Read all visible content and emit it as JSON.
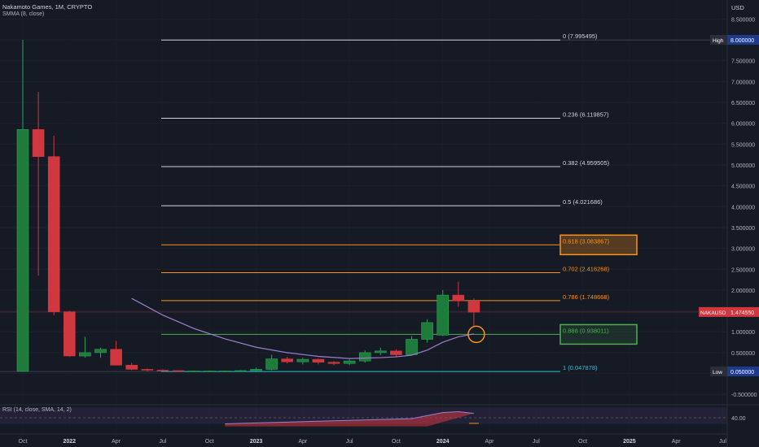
{
  "header": {
    "symbol_line": "Nakamoto Games, 1M, CRYPTO",
    "indicator": "SMMA (8, close)",
    "currency": "USD"
  },
  "rsi_panel": {
    "label": "RSI (14, close, SMA, 14, 2)",
    "tick_label": "40.00",
    "tick_value": 40
  },
  "colors": {
    "background": "#161a25",
    "up": "#26a69a",
    "up_fill": "#1e7b3a",
    "down": "#d1373f",
    "smma": "#9c7fd1",
    "fib_white": "#d1d4dc",
    "fib_orange": "#f7931a",
    "fib_green": "#4caf50",
    "fib_cyan": "#26c6da",
    "highlight_circle": "#f7931a"
  },
  "chart_data": {
    "type": "candlestick",
    "x_labels": [
      "Oct",
      "2022",
      "Apr",
      "Jul",
      "Oct",
      "2023",
      "Apr",
      "Jul",
      "Oct",
      "2024",
      "Apr",
      "Jul",
      "Oct",
      "2025",
      "Apr",
      "Jul"
    ],
    "ylim": [
      -0.5,
      8.4
    ],
    "y_ticks": [
      "8.500000",
      "8.000000",
      "7.500000",
      "7.000000",
      "6.500000",
      "6.000000",
      "5.500000",
      "5.000000",
      "4.500000",
      "4.000000",
      "3.500000",
      "3.000000",
      "2.500000",
      "2.000000",
      "1.500000",
      "1.000000",
      "0.500000",
      "0.000000",
      "-0.500000"
    ],
    "y_tick_values": [
      8.5,
      8.0,
      7.5,
      7.0,
      6.5,
      6.0,
      5.5,
      5.0,
      4.5,
      4.0,
      3.5,
      3.0,
      2.5,
      2.0,
      1.5,
      1.0,
      0.5,
      0.0,
      -0.5
    ],
    "candles": [
      {
        "o": 0.05,
        "h": 8.0,
        "l": 0.05,
        "c": 5.85
      },
      {
        "o": 5.85,
        "h": 6.75,
        "l": 2.35,
        "c": 5.2
      },
      {
        "o": 5.2,
        "h": 5.7,
        "l": 1.4,
        "c": 1.48
      },
      {
        "o": 1.48,
        "h": 1.5,
        "l": 0.4,
        "c": 0.42
      },
      {
        "o": 0.42,
        "h": 0.88,
        "l": 0.38,
        "c": 0.5
      },
      {
        "o": 0.5,
        "h": 0.62,
        "l": 0.38,
        "c": 0.58
      },
      {
        "o": 0.58,
        "h": 0.78,
        "l": 0.22,
        "c": 0.2
      },
      {
        "o": 0.2,
        "h": 0.25,
        "l": 0.08,
        "c": 0.1
      },
      {
        "o": 0.1,
        "h": 0.12,
        "l": 0.06,
        "c": 0.08
      },
      {
        "o": 0.08,
        "h": 0.1,
        "l": 0.06,
        "c": 0.07
      },
      {
        "o": 0.07,
        "h": 0.08,
        "l": 0.05,
        "c": 0.06
      },
      {
        "o": 0.06,
        "h": 0.07,
        "l": 0.05,
        "c": 0.06
      },
      {
        "o": 0.06,
        "h": 0.07,
        "l": 0.05,
        "c": 0.06
      },
      {
        "o": 0.06,
        "h": 0.07,
        "l": 0.05,
        "c": 0.06
      },
      {
        "o": 0.06,
        "h": 0.08,
        "l": 0.05,
        "c": 0.07
      },
      {
        "o": 0.07,
        "h": 0.14,
        "l": 0.05,
        "c": 0.1
      },
      {
        "o": 0.1,
        "h": 0.45,
        "l": 0.08,
        "c": 0.35
      },
      {
        "o": 0.35,
        "h": 0.4,
        "l": 0.24,
        "c": 0.28
      },
      {
        "o": 0.28,
        "h": 0.38,
        "l": 0.22,
        "c": 0.34
      },
      {
        "o": 0.34,
        "h": 0.36,
        "l": 0.22,
        "c": 0.27
      },
      {
        "o": 0.27,
        "h": 0.3,
        "l": 0.2,
        "c": 0.24
      },
      {
        "o": 0.24,
        "h": 0.34,
        "l": 0.2,
        "c": 0.3
      },
      {
        "o": 0.3,
        "h": 0.55,
        "l": 0.26,
        "c": 0.5
      },
      {
        "o": 0.5,
        "h": 0.62,
        "l": 0.44,
        "c": 0.54
      },
      {
        "o": 0.54,
        "h": 0.58,
        "l": 0.4,
        "c": 0.45
      },
      {
        "o": 0.45,
        "h": 0.9,
        "l": 0.43,
        "c": 0.82
      },
      {
        "o": 0.82,
        "h": 1.3,
        "l": 0.74,
        "c": 1.22
      },
      {
        "o": 0.92,
        "h": 2.0,
        "l": 0.9,
        "c": 1.88
      },
      {
        "o": 1.88,
        "h": 2.2,
        "l": 1.6,
        "c": 1.74
      },
      {
        "o": 1.74,
        "h": 1.8,
        "l": 1.12,
        "c": 1.47
      }
    ],
    "smma": [
      {
        "i": 7,
        "v": 1.8
      },
      {
        "i": 9,
        "v": 1.4
      },
      {
        "i": 11,
        "v": 1.08
      },
      {
        "i": 13,
        "v": 0.83
      },
      {
        "i": 15,
        "v": 0.63
      },
      {
        "i": 17,
        "v": 0.5
      },
      {
        "i": 19,
        "v": 0.41
      },
      {
        "i": 21,
        "v": 0.36
      },
      {
        "i": 23,
        "v": 0.38
      },
      {
        "i": 24,
        "v": 0.4
      },
      {
        "i": 25,
        "v": 0.44
      },
      {
        "i": 26,
        "v": 0.56
      },
      {
        "i": 27,
        "v": 0.75
      },
      {
        "i": 28,
        "v": 0.88
      },
      {
        "i": 29,
        "v": 0.95
      }
    ],
    "fib_levels": [
      {
        "label": "0 (7.995495)",
        "value": 7.995495,
        "color": "#d1d4dc",
        "boxed": false
      },
      {
        "label": "0.236 (6.119857)",
        "value": 6.119857,
        "color": "#d1d4dc",
        "boxed": false
      },
      {
        "label": "0.382 (4.959505)",
        "value": 4.959505,
        "color": "#d1d4dc",
        "boxed": false
      },
      {
        "label": "0.5 (4.021686)",
        "value": 4.021686,
        "color": "#d1d4dc",
        "boxed": false
      },
      {
        "label": "0.618 (3.083867)",
        "value": 3.083867,
        "color": "#f7931a",
        "boxed": true
      },
      {
        "label": "0.702 (2.416268)",
        "value": 2.416268,
        "color": "#f7931a",
        "boxed": false
      },
      {
        "label": "0.786 (1.748668)",
        "value": 1.748668,
        "color": "#f7931a",
        "boxed": false
      },
      {
        "label": "0.888 (0.938011)",
        "value": 0.938011,
        "color": "#4caf50",
        "boxed": true
      },
      {
        "label": "1 (0.047878)",
        "value": 0.047878,
        "color": "#26c6da",
        "boxed": false
      }
    ],
    "price_tags": [
      {
        "name": "High",
        "value_label": "8.000000",
        "value": 8.0,
        "color": "#1e3a8a"
      },
      {
        "name": "NAKAUSD",
        "value_label": "1.474550",
        "value": 1.47455,
        "color": "#d1373f"
      },
      {
        "name": "Low",
        "value_label": "0.050000",
        "value": 0.05,
        "color": "#1e3a8a"
      }
    ],
    "rsi_line": [
      {
        "i": 13,
        "v": 33
      },
      {
        "i": 15,
        "v": 34
      },
      {
        "i": 17,
        "v": 35
      },
      {
        "i": 19,
        "v": 36
      },
      {
        "i": 21,
        "v": 37
      },
      {
        "i": 23,
        "v": 38
      },
      {
        "i": 25,
        "v": 39
      },
      {
        "i": 27,
        "v": 46
      },
      {
        "i": 28,
        "v": 47
      },
      {
        "i": 29,
        "v": 45
      }
    ],
    "rsi_ylim": [
      25,
      55
    ]
  }
}
